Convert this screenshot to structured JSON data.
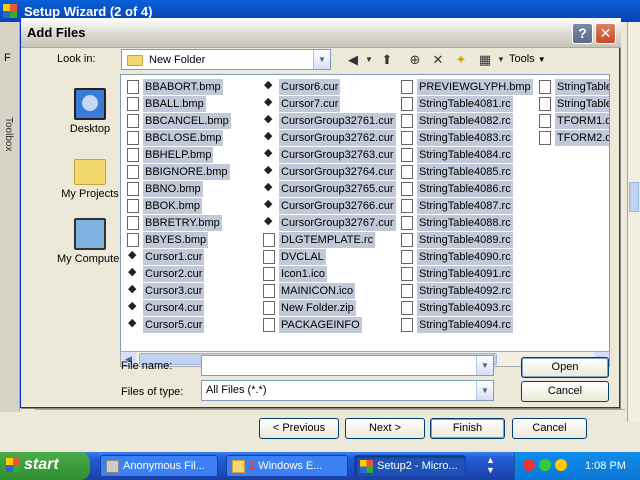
{
  "wizard": {
    "title": "Setup Wizard (2 of 4)",
    "menu_letter": "F",
    "toolbox_label": "Toolbox",
    "buttons": {
      "previous": "< Previous",
      "next": "Next >",
      "finish": "Finish",
      "cancel": "Cancel"
    }
  },
  "dialog": {
    "title": "Add Files",
    "help_glyph": "?",
    "close_glyph": "✕",
    "look_in_label": "Look in:",
    "look_in_value": "New Folder",
    "toolbar": {
      "back_icon": "◀",
      "up_icon": "⬆",
      "search_icon": "⊕",
      "delete_icon": "✕",
      "new_folder_icon": "✦",
      "views_icon": "▦",
      "tools_label": "Tools"
    },
    "places": [
      {
        "label": "Desktop",
        "icon": "desktop-icon"
      },
      {
        "label": "My Projects",
        "icon": "folder-icon"
      },
      {
        "label": "My Computer",
        "icon": "computer-icon"
      }
    ],
    "files": {
      "col1": [
        "BBABORT.bmp",
        "BBALL.bmp",
        "BBCANCEL.bmp",
        "BBCLOSE.bmp",
        "BBHELP.bmp",
        "BBIGNORE.bmp",
        "BBNO.bmp",
        "BBOK.bmp",
        "BBRETRY.bmp",
        "BBYES.bmp",
        "Cursor1.cur",
        "Cursor2.cur",
        "Cursor3.cur",
        "Cursor4.cur",
        "Cursor5.cur"
      ],
      "col2": [
        "Cursor6.cur",
        "Cursor7.cur",
        "CursorGroup32761.cur",
        "CursorGroup32762.cur",
        "CursorGroup32763.cur",
        "CursorGroup32764.cur",
        "CursorGroup32765.cur",
        "CursorGroup32766.cur",
        "CursorGroup32767.cur",
        "DLGTEMPLATE.rc",
        "DVCLAL",
        "Icon1.ico",
        "MAINICON.ico",
        "New Folder.zip",
        "PACKAGEINFO"
      ],
      "col3": [
        "PREVIEWGLYPH.bmp",
        "StringTable4081.rc",
        "StringTable4082.rc",
        "StringTable4083.rc",
        "StringTable4084.rc",
        "StringTable4085.rc",
        "StringTable4086.rc",
        "StringTable4087.rc",
        "StringTable4088.rc",
        "StringTable4089.rc",
        "StringTable4090.rc",
        "StringTable4091.rc",
        "StringTable4092.rc",
        "StringTable4093.rc",
        "StringTable4094.rc"
      ],
      "col4": [
        "StringTable",
        "StringTable",
        "TFORM1.dfi",
        "TFORM2.dfi"
      ]
    },
    "file_name_label": "File name:",
    "file_name_value": "",
    "file_type_label": "Files of type:",
    "file_type_value": "All Files (*.*)",
    "open_button": "Open",
    "cancel_button": "Cancel"
  },
  "taskbar": {
    "start_label": "start",
    "tasks": [
      {
        "label": "Anonymous Fil..."
      },
      {
        "count": "2",
        "label": "Windows E..."
      },
      {
        "label": "Setup2 - Micro..."
      }
    ],
    "clock": "1:08 PM"
  }
}
